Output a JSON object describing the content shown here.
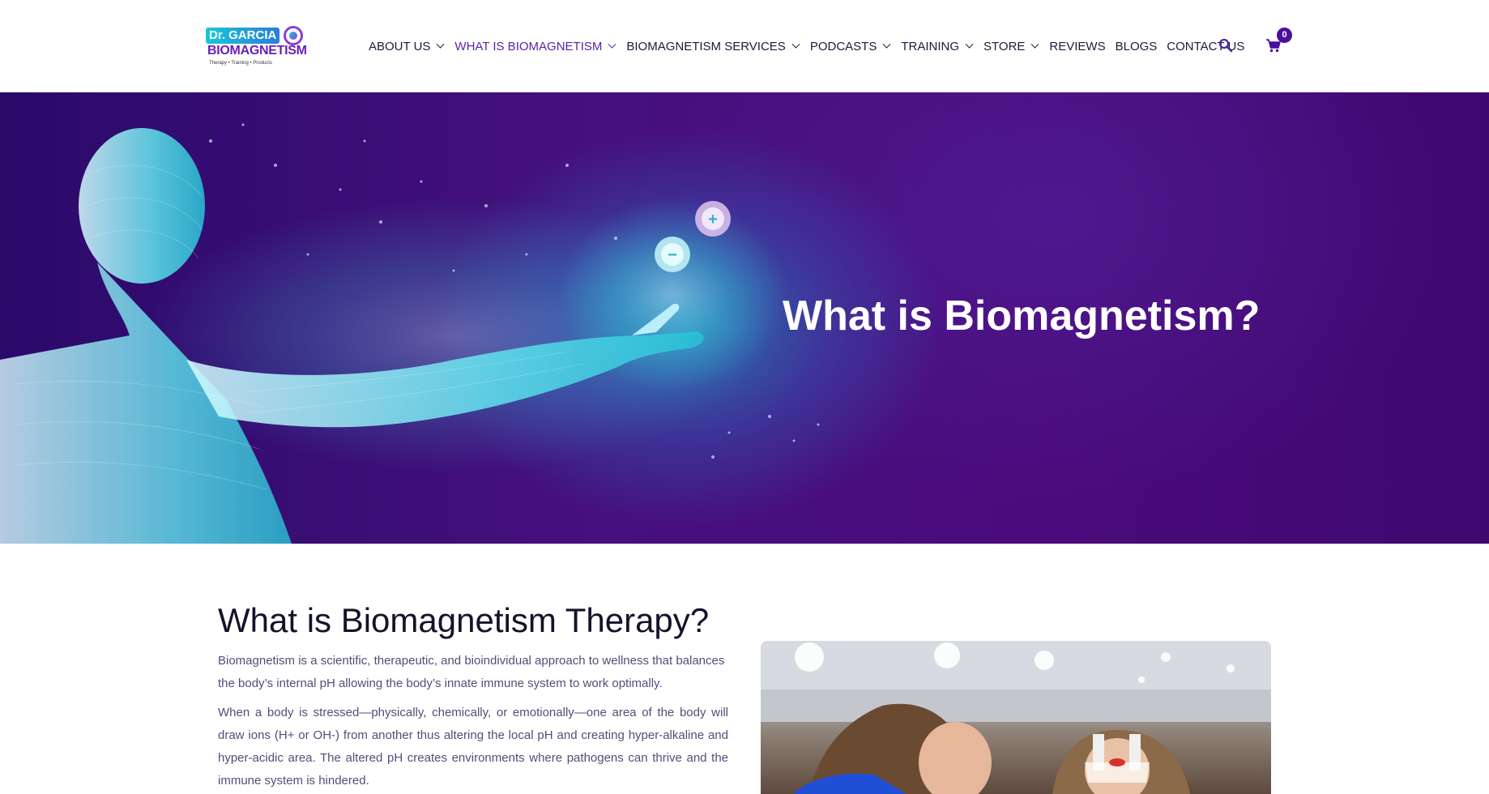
{
  "header": {
    "logo": {
      "line1": "Dr. GARCIA",
      "line2": "BIOMAGNETISM",
      "tagline": "Therapy • Training • Products"
    },
    "nav": [
      {
        "label": "ABOUT US",
        "has_dropdown": true
      },
      {
        "label": "WHAT IS BIOMAGNETISM",
        "has_dropdown": true,
        "active": true
      },
      {
        "label": "BIOMAGNETISM SERVICES",
        "has_dropdown": true
      },
      {
        "label": "PODCASTS",
        "has_dropdown": true
      },
      {
        "label": "TRAINING",
        "has_dropdown": true
      },
      {
        "label": "STORE",
        "has_dropdown": true
      },
      {
        "label": "REVIEWS",
        "has_dropdown": false
      },
      {
        "label": "BLOGS",
        "has_dropdown": false
      },
      {
        "label": "CONTACT US",
        "has_dropdown": false
      }
    ],
    "search_icon": "search-icon",
    "cart_icon": "cart-icon",
    "cart_count": "0"
  },
  "hero": {
    "title": "What is Biomagnetism?",
    "plus_symbol": "+",
    "minus_symbol": "−"
  },
  "content": {
    "heading": "What is Biomagnetism Therapy?",
    "paragraph1": "Biomagnetism is a scientific, therapeutic, and bioindividual approach to wellness that balances the body’s internal pH allowing the body’s innate immune system to work optimally.",
    "paragraph2": "When a body is stressed—physically, chemically, or emotionally—one area of the body will draw ions (H+ or OH-) from another thus altering the local pH and creating hyper-alkaline and hyper-acidic area. The altered pH creates environments where pathogens can thrive and the immune system is hindered."
  },
  "colors": {
    "accent": "#5b1fa8",
    "hero_bg": "#46107e",
    "badge": "#4a0f9e",
    "glow": "#17c7d8"
  }
}
